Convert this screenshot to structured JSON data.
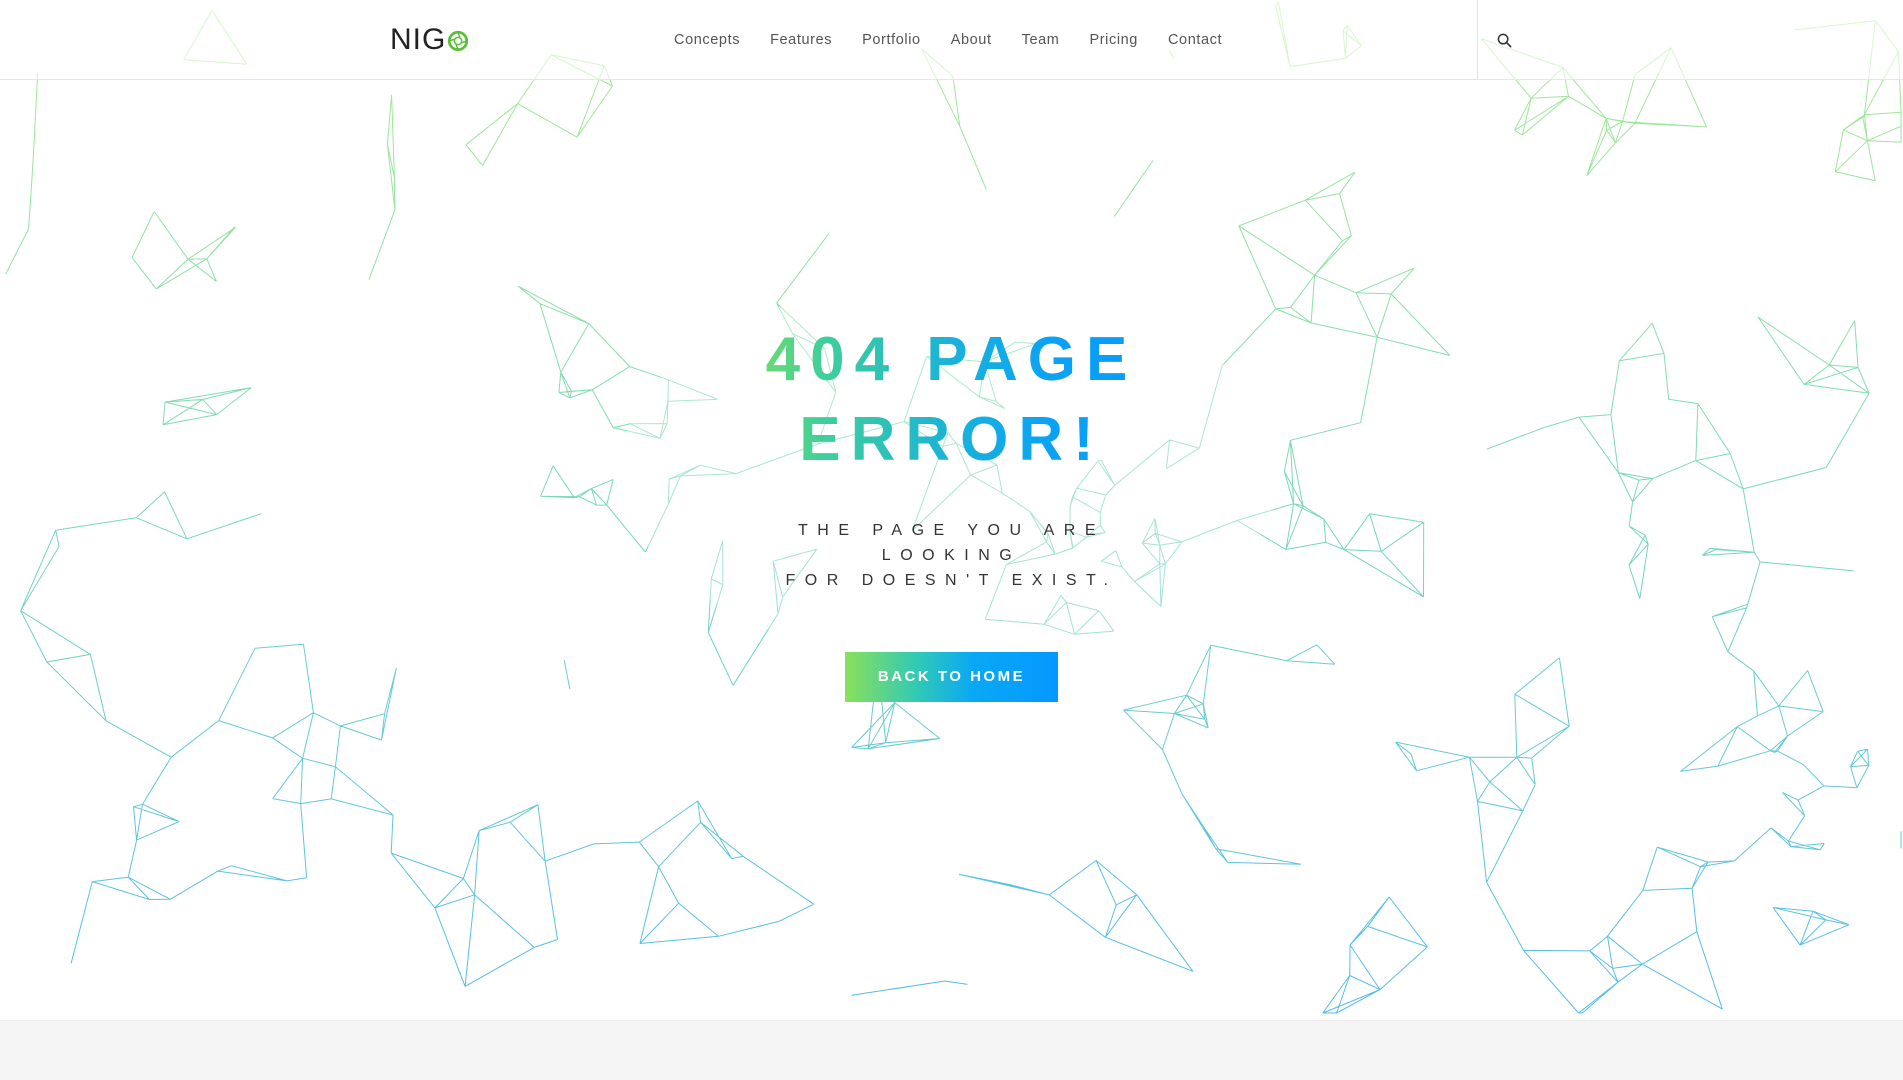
{
  "header": {
    "logo_text": "NIG",
    "logo_icon": "aperture-o-icon",
    "nav": [
      {
        "label": "Concepts"
      },
      {
        "label": "Features"
      },
      {
        "label": "Portfolio"
      },
      {
        "label": "About"
      },
      {
        "label": "Team"
      },
      {
        "label": "Pricing"
      },
      {
        "label": "Contact"
      }
    ],
    "search_icon": "search-icon"
  },
  "hero": {
    "title_line1": "404 PAGE",
    "title_line2": "ERROR!",
    "subtitle_line1": "THE PAGE YOU ARE LOOKING",
    "subtitle_line2": "FOR DOESN'T EXIST.",
    "button_label": "BACK TO HOME"
  },
  "colors": {
    "accent_green": "#8ae05a",
    "accent_blue": "#0598ff",
    "text_dark": "#333333",
    "nav_text": "#555555",
    "footer_bg": "#f5f5f5"
  },
  "background": {
    "pattern": "polygon-network",
    "gradient_top": "#8fe36b",
    "gradient_bottom": "#1aa3e8"
  }
}
